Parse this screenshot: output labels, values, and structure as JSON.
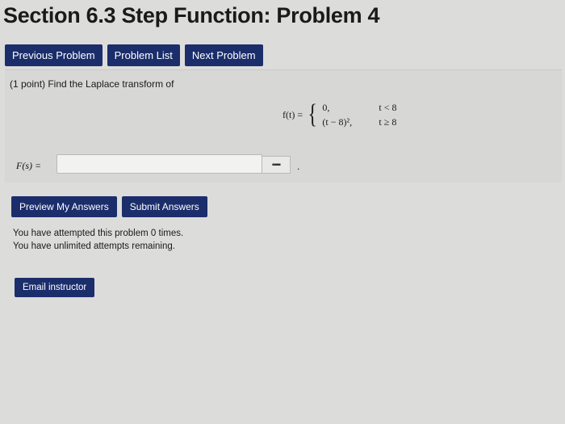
{
  "page_title": "Section 6.3 Step Function: Problem 4",
  "nav": {
    "previous": "Previous Problem",
    "list": "Problem List",
    "next": "Next Problem"
  },
  "problem": {
    "prompt": "(1 point) Find the Laplace transform of",
    "formula": {
      "lhs": "f(t) =",
      "brace": "{",
      "case1_value": "0,",
      "case1_condition": "t < 8",
      "case2_value": "(t − 8)², ",
      "case2_condition": "t ≥ 8"
    },
    "answer_label": "F(s) =",
    "answer_value": "",
    "equation_editor_icon": "keyboard-grid-icon",
    "trailing_period": "."
  },
  "actions": {
    "preview": "Preview My Answers",
    "submit": "Submit Answers"
  },
  "status": {
    "attempts": "You have attempted this problem 0 times.",
    "remaining": "You have unlimited attempts remaining."
  },
  "email_button": "Email instructor",
  "colors": {
    "button_bg": "#1b2e6b",
    "button_text": "#ffffff",
    "page_bg": "#dcdcda"
  }
}
